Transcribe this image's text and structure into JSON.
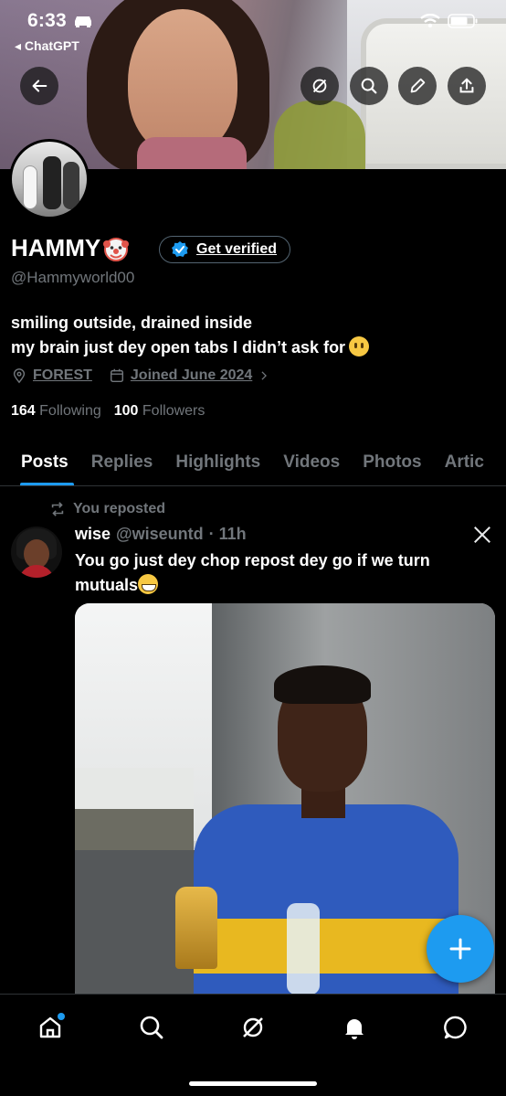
{
  "status_bar": {
    "time": "6:33",
    "back_app": "ChatGPT"
  },
  "profile": {
    "display_name": "HAMMY",
    "get_verified_label": "Get verified",
    "handle": "@Hammyworld00",
    "bio_line1": "smiling outside, drained inside",
    "bio_line2": "my brain just dey open tabs I didn’t ask for",
    "location": "FOREST",
    "joined": "Joined June 2024",
    "following_count": "164",
    "following_label": "Following",
    "followers_count": "100",
    "followers_label": "Followers"
  },
  "tabs": [
    "Posts",
    "Replies",
    "Highlights",
    "Videos",
    "Photos",
    "Artic"
  ],
  "active_tab": "Posts",
  "post": {
    "repost_label": "You reposted",
    "author_name": "wise",
    "author_handle": "@wiseuntd",
    "time": "· 11h",
    "text": "You go just dey chop repost dey go if we turn mutuals"
  },
  "icons": {
    "header": [
      "back-arrow-icon",
      "grok-icon",
      "search-icon",
      "edit-pencil-icon",
      "share-icon"
    ],
    "nav": [
      "home-icon",
      "search-icon",
      "grok-icon",
      "bell-icon",
      "message-icon"
    ],
    "fab": "plus-icon"
  },
  "colors": {
    "accent": "#1d9bf0",
    "muted": "#71767b",
    "background": "#000000"
  }
}
